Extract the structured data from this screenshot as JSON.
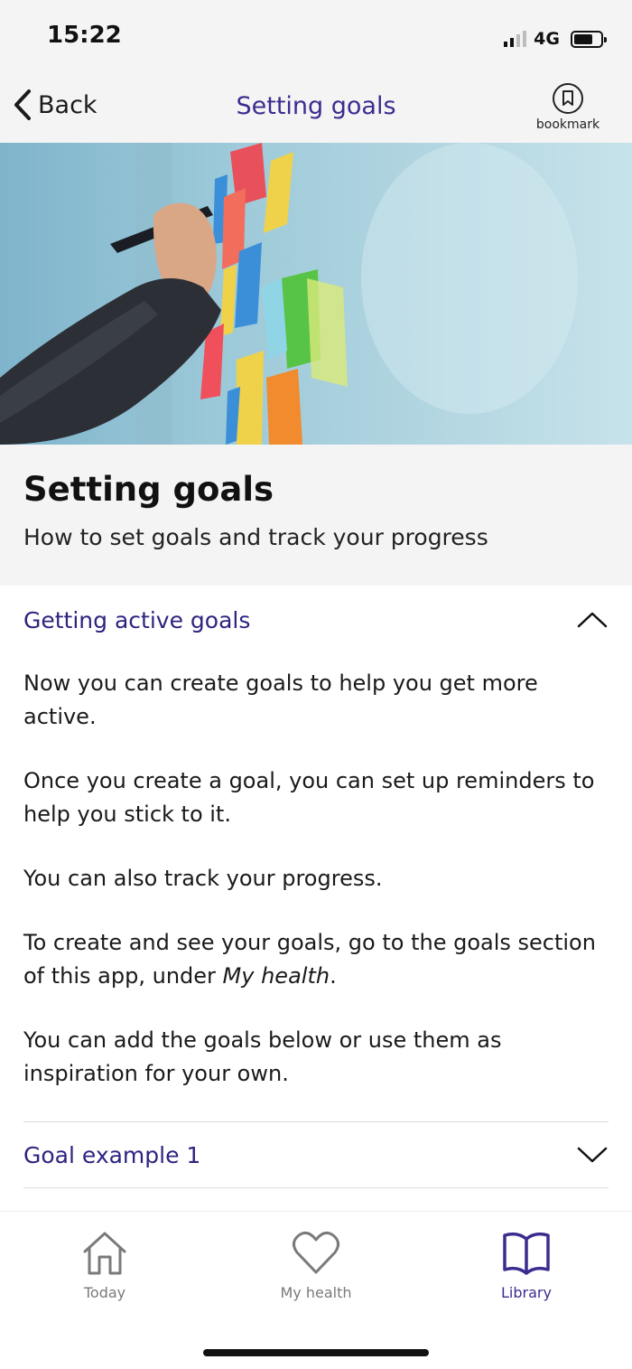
{
  "status": {
    "time": "15:22",
    "network": "4G"
  },
  "nav": {
    "back_label": "Back",
    "title": "Setting goals",
    "bookmark_label": "bookmark"
  },
  "article": {
    "title": "Setting goals",
    "subtitle": "How to set goals and track your progress"
  },
  "section": {
    "title": "Getting active goals",
    "paragraphs": [
      "Now you can create goals to help you get more active.",
      "Once you create a goal, you can set up reminders to help you stick to it.",
      "You can also track your progress.",
      "To create and see your goals, go to the goals section of this app, under",
      "You can add the goals below or use them as inspiration for your own."
    ],
    "emphasis": "My health",
    "emphasis_suffix": "."
  },
  "collapsed_section": {
    "title": "Goal example 1"
  },
  "tabs": [
    {
      "label": "Today",
      "icon": "home-icon"
    },
    {
      "label": "My health",
      "icon": "heart-icon"
    },
    {
      "label": "Library",
      "icon": "book-icon",
      "active": true
    }
  ],
  "colors": {
    "accent": "#3a2d8f",
    "section_heading": "#2d2480",
    "header_bg": "#f4f4f4",
    "inactive_tab": "#7a7a7a"
  }
}
